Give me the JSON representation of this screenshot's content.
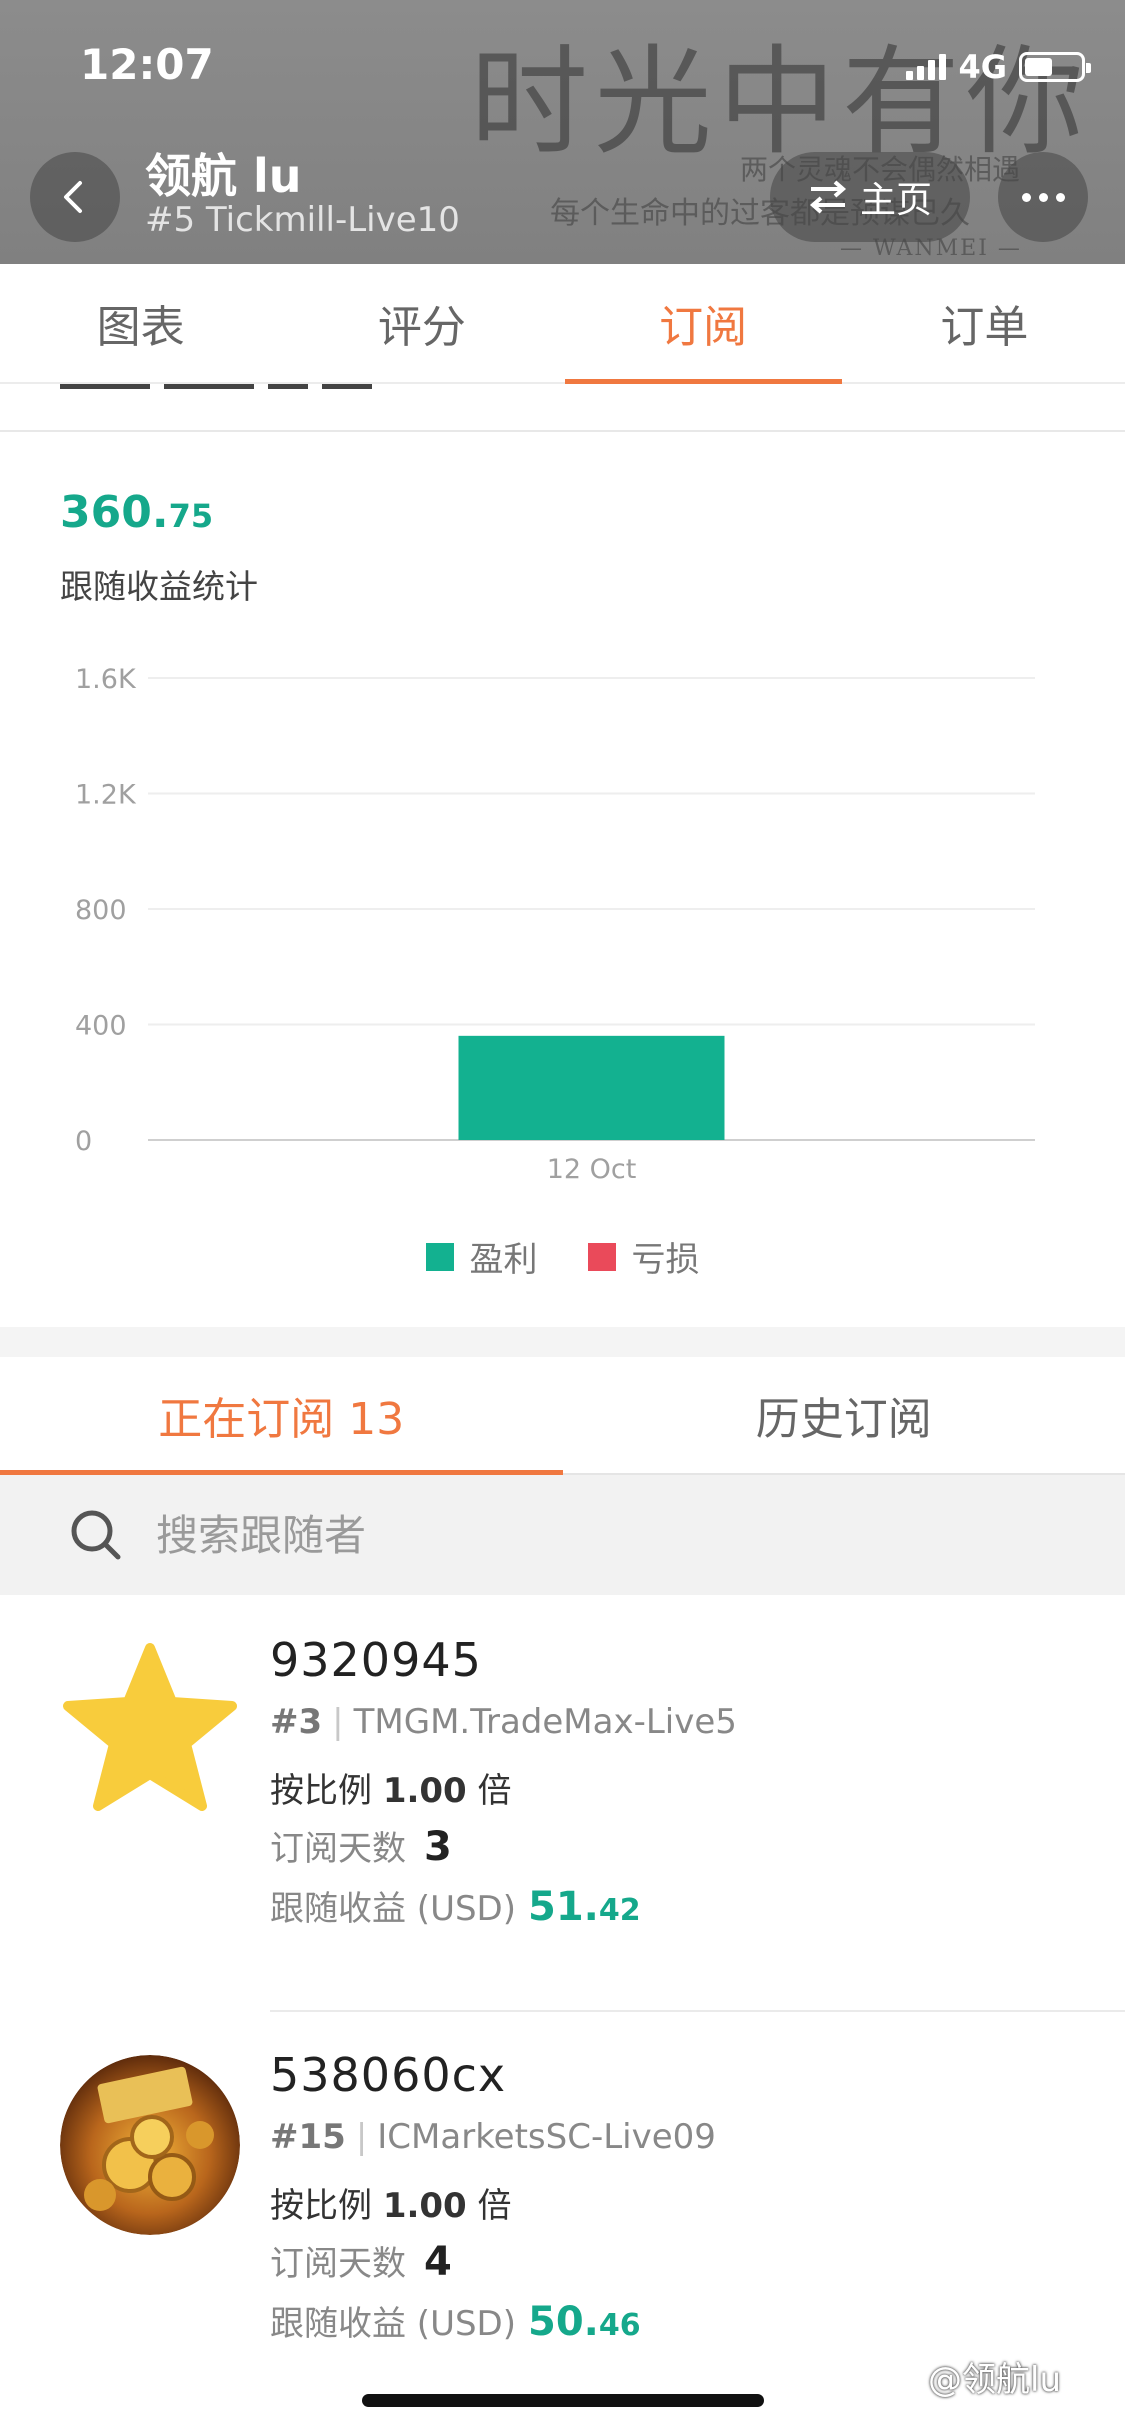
{
  "status_bar": {
    "time": "12:07",
    "network": "4G"
  },
  "header": {
    "title": "领航 lu",
    "subtitle": "#5 Tickmill-Live10",
    "home_label": "主页",
    "bg_deco": {
      "big": "时光中有你",
      "line1": "两个灵魂不会偶然相遇",
      "line2": "每个生命中的过客都是预谋已久",
      "line3": "— WANMEI —"
    }
  },
  "tabs": [
    {
      "label": "图表"
    },
    {
      "label": "评分"
    },
    {
      "label": "订阅",
      "active": true
    },
    {
      "label": "订单"
    }
  ],
  "summary": {
    "profit_int": "360.",
    "profit_dec": "75",
    "caption": "跟随收益统计"
  },
  "chart_data": {
    "type": "bar",
    "categories": [
      "12 Oct"
    ],
    "series": [
      {
        "name": "盈利",
        "values": [
          360.75
        ],
        "color": "#13b190"
      },
      {
        "name": "亏损",
        "values": [
          0
        ],
        "color": "#ea4a5a"
      }
    ],
    "yticks": [
      "0",
      "400",
      "800",
      "1.2K",
      "1.6K"
    ],
    "ylim": [
      0,
      1600
    ],
    "grid": true,
    "legend_position": "bottom"
  },
  "sub_tabs": [
    {
      "label": "正在订阅 13",
      "active": true
    },
    {
      "label": "历史订阅"
    }
  ],
  "search": {
    "placeholder": "搜索跟随者"
  },
  "followers": [
    {
      "name": "9320945",
      "rank": "#3",
      "server": "TMGM.TradeMax-Live5",
      "ratio_label": "按比例",
      "ratio_value": "1.00",
      "ratio_unit": "倍",
      "days_label": "订阅天数",
      "days": "3",
      "profit_label": "跟随收益 (USD)",
      "profit_int": "51.",
      "profit_dec": "42",
      "avatar": "star-avatar"
    },
    {
      "name": "538060cx",
      "rank": "#15",
      "server": "ICMarketsSC-Live09",
      "ratio_label": "按比例",
      "ratio_value": "1.00",
      "ratio_unit": "倍",
      "days_label": "订阅天数",
      "days": "4",
      "profit_label": "跟随收益 (USD)",
      "profit_int": "50.",
      "profit_dec": "46",
      "avatar": "gold-coins-avatar"
    }
  ],
  "watermark": "@领航lu",
  "colors": {
    "accent": "#f07840",
    "profit": "#15a88b",
    "loss": "#ea4a5a",
    "header_bg": "#8a8a8a"
  }
}
